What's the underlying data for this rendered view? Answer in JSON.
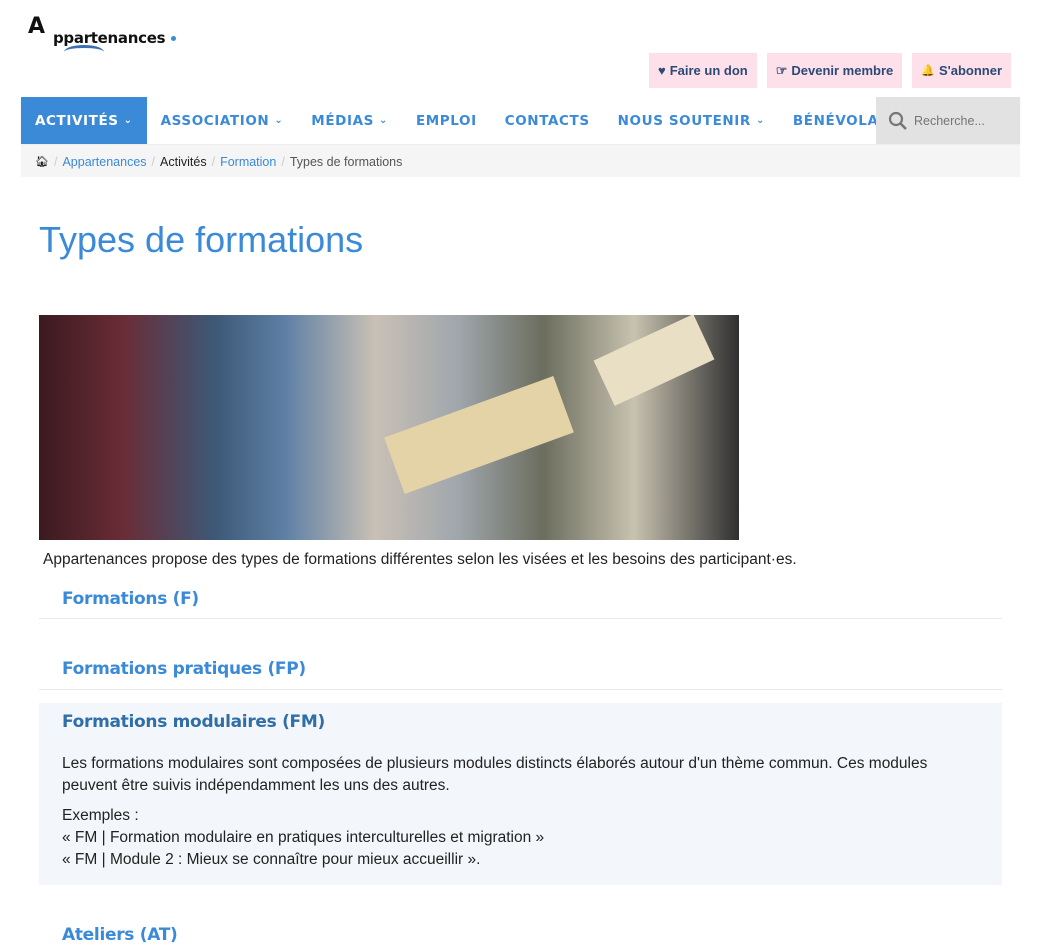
{
  "logo": {
    "text": "Appartenances",
    "initial": "A",
    "rest": "ppartenances"
  },
  "topbar": [
    {
      "icon": "heart-icon",
      "glyph": "♥",
      "label": "Faire un don"
    },
    {
      "icon": "thumbs-up-icon",
      "glyph": "☞",
      "label": "Devenir membre"
    },
    {
      "icon": "bell-icon",
      "glyph": "🔔",
      "label": "S'abonner"
    }
  ],
  "nav": [
    {
      "label": "ACTIVITÉS",
      "dropdown": true,
      "active": true
    },
    {
      "label": "ASSOCIATION",
      "dropdown": true
    },
    {
      "label": "MÉDIAS",
      "dropdown": true
    },
    {
      "label": "EMPLOI"
    },
    {
      "label": "CONTACTS"
    },
    {
      "label": "NOUS SOUTENIR",
      "dropdown": true
    },
    {
      "label": "BÉNÉVOLAT"
    }
  ],
  "search": {
    "placeholder": "Recherche..."
  },
  "breadcrumb": [
    "Appartenances",
    "Activités",
    "Formation",
    "Types de formations"
  ],
  "page": {
    "title": "Types de formations",
    "intro": "Appartenances propose des types de formations différentes selon les visées et les besoins des participant·es."
  },
  "accordion": [
    {
      "title": "Formations (F)"
    },
    {
      "title": "Formations pratiques (FP)"
    },
    {
      "title": "Formations modulaires (FM)",
      "body": "Les formations modulaires sont composées de plusieurs modules distincts élaborés autour d'un thème commun. Ces modules peuvent être suivis indépendamment les uns des autres.",
      "examples_label": "Exemples :",
      "examples": [
        "« FM | Formation modulaire en pratiques interculturelles et migration »",
        "« FM | Module 2 : Mieux se connaître pour mieux accueillir »."
      ]
    },
    {
      "title": "Ateliers (AT)"
    }
  ]
}
